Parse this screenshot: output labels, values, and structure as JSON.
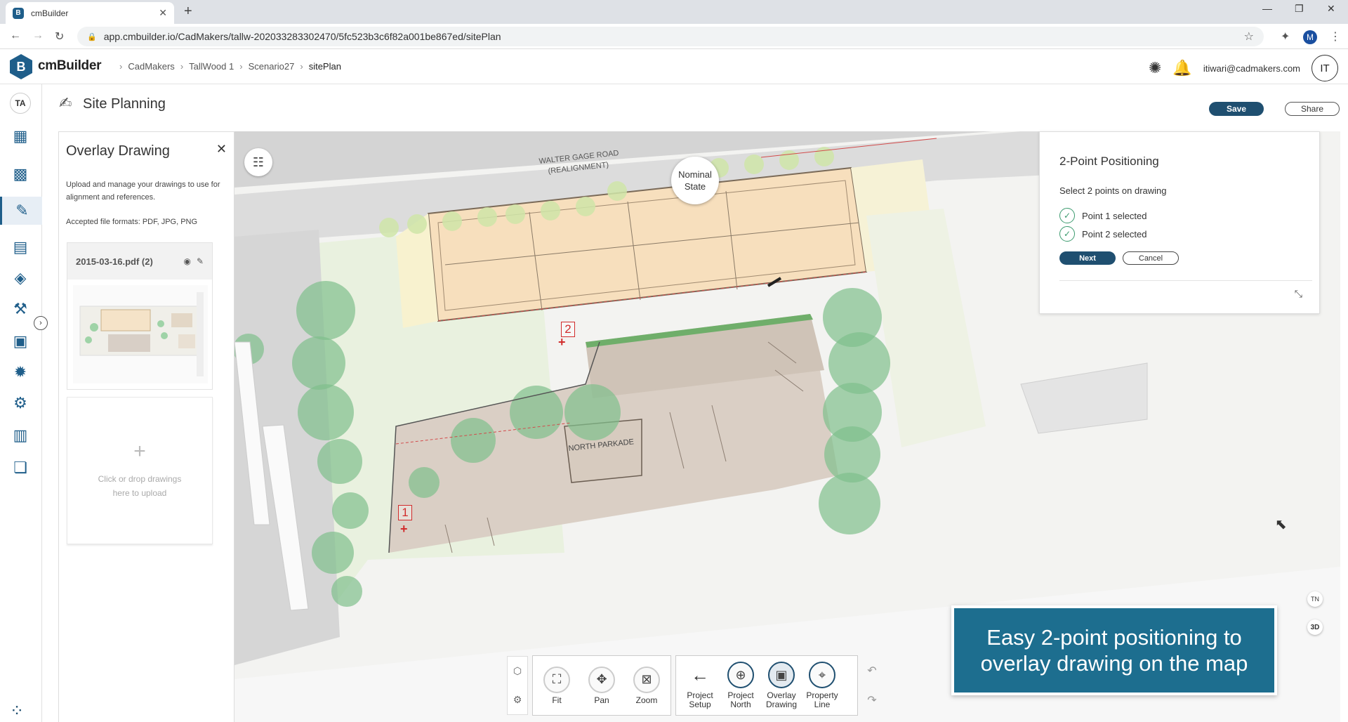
{
  "browser": {
    "tab_title": "cmBuilder",
    "tab_favicon": "B",
    "url": "app.cmbuilder.io/CadMakers/tallw-202033283302470/5fc523b3c6f82a001be867ed/sitePlan",
    "profile_initial": "M"
  },
  "app": {
    "logo_letter": "B",
    "logo_text": "cmBuilder",
    "breadcrumb": [
      "CadMakers",
      "TallWood 1",
      "Scenario27",
      "sitePlan"
    ],
    "user_email": "itiwari@cadmakers.com",
    "user_initials": "IT",
    "nav_initials": "TA",
    "accent_color": "#1f4f70"
  },
  "page": {
    "title": "Site Planning",
    "save_label": "Save",
    "share_label": "Share"
  },
  "overlay_panel": {
    "title": "Overlay Drawing",
    "description": "Upload and manage your drawings to use for alignment and references.",
    "formats": "Accepted file formats: PDF, JPG, PNG",
    "file_name": "2015-03-16.pdf (2)",
    "upload_text": "Click or drop drawings here to upload"
  },
  "map": {
    "nominal_line1": "Nominal",
    "nominal_line2": "State",
    "point1_label": "1",
    "point2_label": "2",
    "street_label_1": "WALTER GAGE ROAD",
    "street_label_2": "(REALIGNMENT)",
    "parkade_label": "NORTH PARKADE",
    "badge_tn": "TN",
    "badge_3d": "3D"
  },
  "positioning": {
    "title": "2-Point Positioning",
    "subtitle": "Select 2 points on drawing",
    "point1": "Point 1 selected",
    "point2": "Point 2 selected",
    "next_label": "Next",
    "cancel_label": "Cancel"
  },
  "toolbar": {
    "fit": "Fit",
    "pan": "Pan",
    "zoom": "Zoom",
    "project_setup_1": "Project",
    "project_setup_2": "Setup",
    "project_north_1": "Project",
    "project_north_2": "North",
    "overlay_drawing_1": "Overlay",
    "overlay_drawing_2": "Drawing",
    "property_line_1": "Property",
    "property_line_2": "Line"
  },
  "caption": {
    "text": "Easy 2-point positioning to overlay drawing on the map"
  }
}
